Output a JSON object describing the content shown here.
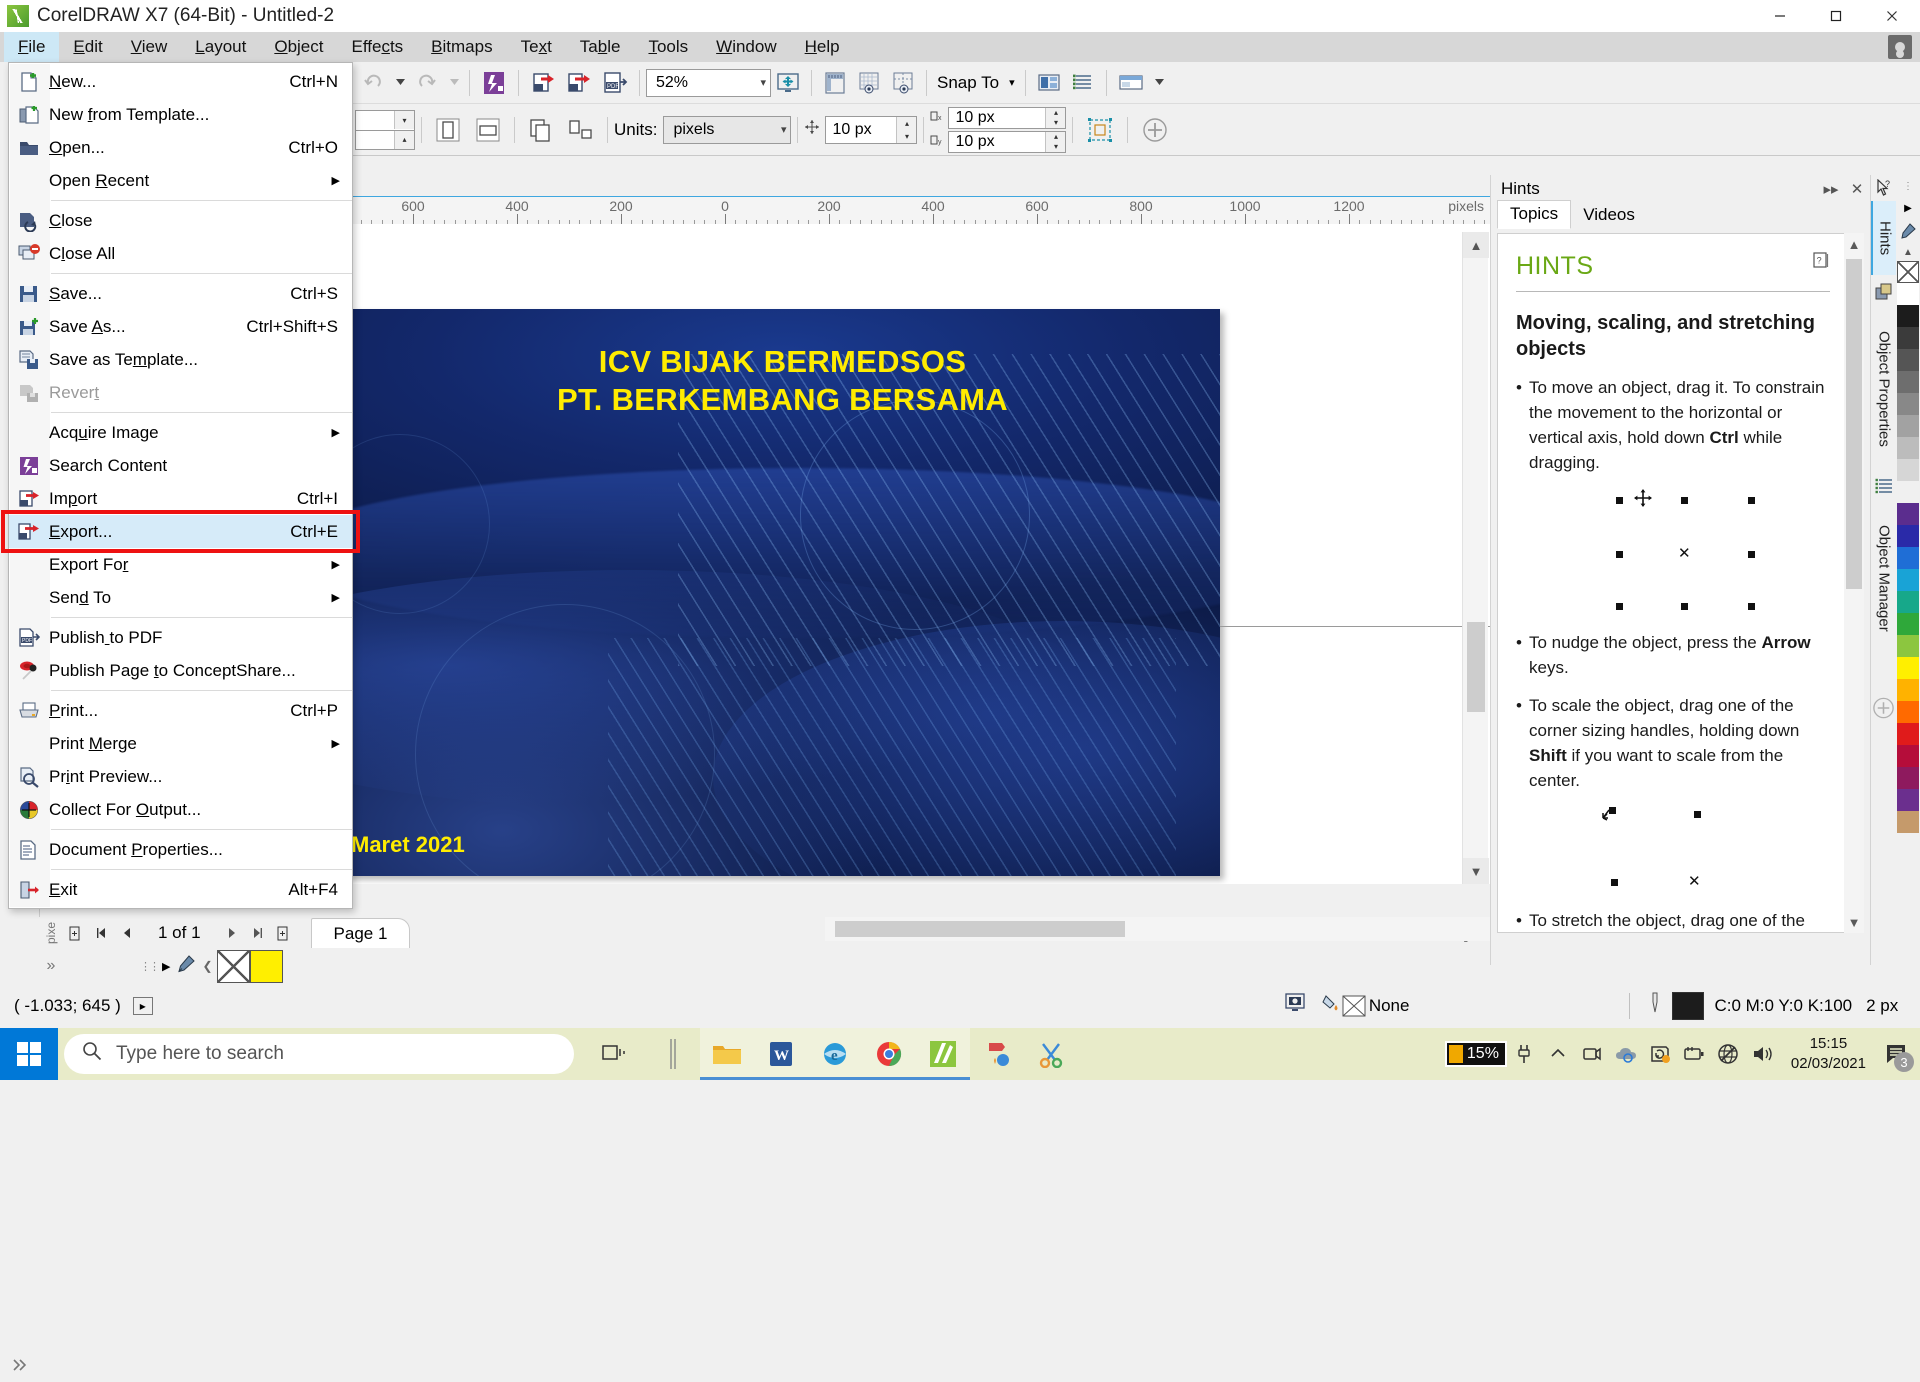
{
  "window": {
    "title": "CorelDRAW X7 (64-Bit) - Untitled-2",
    "logo_icon": "coreldraw-logo-icon",
    "minimize": "–",
    "maximize": "❐",
    "close": "✕",
    "user_icon": "user-account-icon"
  },
  "menubar": {
    "items": [
      {
        "label": "File",
        "access": "F",
        "active": true
      },
      {
        "label": "Edit",
        "access": "E",
        "active": false
      },
      {
        "label": "View",
        "access": "V",
        "active": false
      },
      {
        "label": "Layout",
        "access": "L",
        "active": false
      },
      {
        "label": "Object",
        "access": "O",
        "active": false
      },
      {
        "label": "Effects",
        "access": "c",
        "active": false
      },
      {
        "label": "Bitmaps",
        "access": "B",
        "active": false
      },
      {
        "label": "Text",
        "access": "x",
        "active": false
      },
      {
        "label": "Table",
        "access": "b",
        "active": false
      },
      {
        "label": "Tools",
        "access": "T",
        "active": false
      },
      {
        "label": "Window",
        "access": "W",
        "active": false
      },
      {
        "label": "Help",
        "access": "H",
        "active": false
      }
    ]
  },
  "file_menu": {
    "items": [
      {
        "label": "New...",
        "accel": "Ctrl+N",
        "icon": "new-document-icon",
        "has_icon": true,
        "disabled": false,
        "submenu": false,
        "selected": false
      },
      {
        "label": "New from Template...",
        "accel": "",
        "icon": "new-from-template-icon",
        "has_icon": true,
        "disabled": false,
        "submenu": false,
        "selected": false
      },
      {
        "label": "Open...",
        "accel": "Ctrl+O",
        "icon": "open-folder-icon",
        "has_icon": true,
        "disabled": false,
        "submenu": false,
        "selected": false
      },
      {
        "label": "Open Recent",
        "accel": "",
        "icon": "",
        "has_icon": false,
        "disabled": false,
        "submenu": true,
        "selected": false
      },
      {
        "divider": true
      },
      {
        "label": "Close",
        "accel": "",
        "icon": "close-document-icon",
        "has_icon": true,
        "disabled": false,
        "submenu": false,
        "selected": false
      },
      {
        "label": "Close All",
        "accel": "",
        "icon": "close-all-icon",
        "has_icon": true,
        "disabled": false,
        "submenu": false,
        "selected": false
      },
      {
        "divider": true
      },
      {
        "label": "Save...",
        "accel": "Ctrl+S",
        "icon": "save-disk-icon",
        "has_icon": true,
        "disabled": false,
        "submenu": false,
        "selected": false
      },
      {
        "label": "Save As...",
        "accel": "Ctrl+Shift+S",
        "icon": "save-as-icon",
        "has_icon": true,
        "disabled": false,
        "submenu": false,
        "selected": false
      },
      {
        "label": "Save as Template...",
        "accel": "",
        "icon": "save-as-template-icon",
        "has_icon": true,
        "disabled": false,
        "submenu": false,
        "selected": false
      },
      {
        "label": "Revert",
        "accel": "",
        "icon": "revert-icon",
        "has_icon": true,
        "disabled": true,
        "submenu": false,
        "selected": false
      },
      {
        "divider": true
      },
      {
        "label": "Acquire Image",
        "accel": "",
        "icon": "",
        "has_icon": false,
        "disabled": false,
        "submenu": true,
        "selected": false
      },
      {
        "label": "Search Content",
        "accel": "",
        "icon": "search-content-icon",
        "has_icon": true,
        "disabled": false,
        "submenu": false,
        "selected": false
      },
      {
        "label": "Import",
        "accel": "Ctrl+I",
        "icon": "import-icon",
        "has_icon": true,
        "disabled": false,
        "submenu": false,
        "selected": false
      },
      {
        "label": "Export...",
        "accel": "Ctrl+E",
        "icon": "export-icon",
        "has_icon": true,
        "disabled": false,
        "submenu": false,
        "selected": true
      },
      {
        "label": "Export For",
        "accel": "",
        "icon": "",
        "has_icon": false,
        "disabled": false,
        "submenu": true,
        "selected": false
      },
      {
        "label": "Send To",
        "accel": "",
        "icon": "",
        "has_icon": false,
        "disabled": false,
        "submenu": true,
        "selected": false
      },
      {
        "divider": true
      },
      {
        "label": "Publish to PDF",
        "accel": "",
        "icon": "publish-pdf-icon",
        "has_icon": true,
        "disabled": false,
        "submenu": false,
        "selected": false
      },
      {
        "label": "Publish Page to ConceptShare...",
        "accel": "",
        "icon": "conceptshare-icon",
        "has_icon": true,
        "disabled": false,
        "submenu": false,
        "selected": false
      },
      {
        "divider": true
      },
      {
        "label": "Print...",
        "accel": "Ctrl+P",
        "icon": "printer-icon",
        "has_icon": true,
        "disabled": false,
        "submenu": false,
        "selected": false
      },
      {
        "label": "Print Merge",
        "accel": "",
        "icon": "",
        "has_icon": false,
        "disabled": false,
        "submenu": true,
        "selected": false
      },
      {
        "label": "Print Preview...",
        "accel": "",
        "icon": "print-preview-icon",
        "has_icon": true,
        "disabled": false,
        "submenu": false,
        "selected": false
      },
      {
        "label": "Collect For Output...",
        "accel": "",
        "icon": "collect-output-icon",
        "has_icon": true,
        "disabled": false,
        "submenu": false,
        "selected": false
      },
      {
        "divider": true
      },
      {
        "label": "Document Properties...",
        "accel": "",
        "icon": "document-properties-icon",
        "has_icon": true,
        "disabled": false,
        "submenu": false,
        "selected": false
      },
      {
        "divider": true
      },
      {
        "label": "Exit",
        "accel": "Alt+F4",
        "icon": "exit-icon",
        "has_icon": true,
        "disabled": false,
        "submenu": false,
        "selected": false
      }
    ],
    "highlight_color": "#ee1111"
  },
  "toolbar_top": {
    "undo_icon": "undo-icon",
    "redo_icon": "redo-icon",
    "search_content_icon": "search-content-icon",
    "import_icon": "import-icon",
    "export_icon": "export-icon",
    "publish_pdf_icon": "publish-pdf-icon",
    "zoom_value": "52%",
    "fullscreen_icon": "fullscreen-preview-icon",
    "ruler_icon": "show-rulers-icon",
    "grid_icon": "show-grid-icon",
    "guides_icon": "show-guides-icon",
    "snap_label": "Snap To",
    "options_icon": "options-icon",
    "object_manager_icon": "object-manager-icon",
    "layout_icon": "page-layout-icon"
  },
  "toolbar_props": {
    "portrait_icon": "portrait-orientation-icon",
    "landscape_icon": "landscape-orientation-icon",
    "all_pages_icon": "all-pages-icon",
    "current_page_icon": "current-page-icon",
    "units_label": "Units:",
    "units_value": "pixels",
    "nudge_icon": "nudge-offset-icon",
    "nudge_value": "10 px",
    "duplicate_x_icon": "duplicate-distance-x-icon",
    "duplicate_x_value": "10 px",
    "duplicate_y_icon": "duplicate-distance-y-icon",
    "duplicate_y_value": "10 px",
    "edit_scale_icon": "edit-scale-icon",
    "add_icon": "plus-circle-icon"
  },
  "toolbox": {
    "tools": [
      {
        "icon": "pick-tool-icon",
        "name": "pick-tool"
      },
      {
        "icon": "shape-tool-icon",
        "name": "shape-tool"
      },
      {
        "icon": "crop-tool-icon",
        "name": "crop-tool"
      },
      {
        "icon": "zoom-tool-icon",
        "name": "zoom-tool"
      },
      {
        "icon": "freehand-tool-icon",
        "name": "freehand-tool"
      },
      {
        "icon": "smart-fill-icon",
        "name": "smart-fill-tool"
      },
      {
        "icon": "rectangle-tool-icon",
        "name": "rectangle-tool"
      },
      {
        "icon": "ellipse-tool-icon",
        "name": "ellipse-tool"
      },
      {
        "icon": "polygon-tool-icon",
        "name": "polygon-tool"
      },
      {
        "icon": "text-tool-icon",
        "name": "text-tool"
      },
      {
        "icon": "table-tool-icon",
        "name": "table-tool"
      },
      {
        "icon": "parallel-dimension-icon",
        "name": "dimension-tool"
      },
      {
        "icon": "straight-line-connector-icon",
        "name": "connector-tool"
      },
      {
        "icon": "blend-tool-icon",
        "name": "blend-tool"
      },
      {
        "icon": "color-eyedropper-icon",
        "name": "eyedropper-tool"
      },
      {
        "icon": "outline-pen-icon",
        "name": "outline-tool"
      },
      {
        "icon": "fill-tool-icon",
        "name": "fill-tool"
      },
      {
        "icon": "interactive-fill-icon",
        "name": "interactive-fill-tool"
      }
    ]
  },
  "ruler": {
    "unit_label": "pixels",
    "ticks": [
      -600,
      -400,
      -200,
      0,
      200,
      400,
      600,
      800,
      1000,
      1200
    ],
    "tick_labels": [
      "600",
      "400",
      "200",
      "0",
      "200",
      "400",
      "600",
      "800",
      "1000",
      "1200"
    ]
  },
  "canvas": {
    "slide_title_line1": "ICV BIJAK BERMEDSOS",
    "slide_title_line2": "PT. BERKEMBANG BERSAMA",
    "slide_date": "Maret 2021",
    "title_color": "#ffec00"
  },
  "pagebar": {
    "add_page_start_icon": "add-page-start-icon",
    "first_icon": "⏮",
    "prev_icon": "◀",
    "counter": "1 of 1",
    "next_icon": "▶",
    "last_icon": "⏭",
    "add_page_end_icon": "add-page-end-icon",
    "page_tab": "Page 1"
  },
  "colorstrip": {
    "expand_icon": "expand-palette-icon",
    "eyedropper_icon": "eyedropper-icon",
    "no_color_icon": "no-color-swatch",
    "yellow_swatch": "#ffef00"
  },
  "statusbar": {
    "coordinates": "( -1.033; 645  )",
    "expand_icon": "▸",
    "screen_icon": "color-proof-icon",
    "fill_icon": "fill-color-icon",
    "fill_value": "None",
    "outline_icon": "outline-pen-icon",
    "outline_color": "#1c1c1c",
    "outline_value": "C:0 M:0 Y:0 K:100",
    "outline_width": "2 px"
  },
  "hints": {
    "panel_title": "Hints",
    "collapse_icon": "▸▸",
    "close_icon": "✕",
    "tabs": [
      {
        "label": "Topics",
        "selected": true
      },
      {
        "label": "Videos",
        "selected": false
      }
    ],
    "heading": "HINTS",
    "heading_color": "#6aa815",
    "help_icon": "help-topic-icon",
    "subheading": "Moving, scaling, and stretching objects",
    "bullets": [
      "To move an object, drag it. To constrain the movement to the horizontal or vertical axis, hold down Ctrl while dragging.",
      "To nudge the object, press the Arrow keys.",
      "To scale the object, drag one of the corner sizing handles, holding down Shift if you want to scale from the center.",
      "To stretch the object, drag one of the"
    ],
    "scroll_up_icon": "⌃",
    "scroll_down_icon": "⌄"
  },
  "dock_tabs": [
    {
      "label": "Hints",
      "icon": "hints-cursor-icon",
      "selected": true
    },
    {
      "label": "Object Properties",
      "icon": "object-properties-icon",
      "selected": false
    },
    {
      "label": "Object Manager",
      "icon": "object-manager-icon",
      "selected": false
    }
  ],
  "palette_colors": [
    "#ffffff",
    "#1c1c1c",
    "#3b3b3b",
    "#555555",
    "#6e6e6e",
    "#888888",
    "#a2a2a2",
    "#bcbcbc",
    "#d6d6d6",
    "#f0f0f0",
    "#5b2d8e",
    "#2a2aa8",
    "#1f6ed6",
    "#19a3d6",
    "#17a88a",
    "#2fa83a",
    "#8cc63f",
    "#ffef00",
    "#ffb200",
    "#ff6a00",
    "#e01b1b",
    "#b50d3a",
    "#8e1a5e",
    "#6b2f8e",
    "#c59a6b"
  ],
  "taskbar": {
    "start_icon": "windows-start-icon",
    "search_placeholder": "Type here to search",
    "search_icon": "search-icon",
    "taskview_icon": "task-view-icon",
    "apps": [
      {
        "icon": "file-explorer-icon",
        "name": "file-explorer",
        "active": true
      },
      {
        "icon": "word-icon",
        "name": "microsoft-word",
        "active": true
      },
      {
        "icon": "internet-explorer-icon",
        "name": "internet-explorer",
        "active": true
      },
      {
        "icon": "chrome-icon",
        "name": "google-chrome",
        "active": true
      },
      {
        "icon": "coreldraw-icon",
        "name": "coreldraw",
        "active": true
      },
      {
        "icon": "paint-icon",
        "name": "paint",
        "active": false
      },
      {
        "icon": "scissors-icon",
        "name": "snipping-tool",
        "active": false
      }
    ],
    "battery_percent": "15%",
    "tray_icons": [
      "plug-charging-icon",
      "show-hidden-icon",
      "camera-icon",
      "onedrive-icon",
      "sync-icon",
      "battery-saver-icon",
      "network-no-internet-icon",
      "volume-icon"
    ],
    "time": "15:15",
    "date": "02/03/2021",
    "notification_icon": "notification-icon",
    "notification_count": "3"
  }
}
